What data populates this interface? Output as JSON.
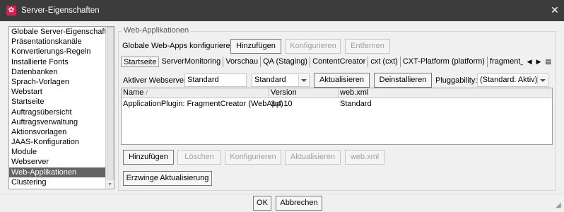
{
  "window": {
    "title": "Server-Eigenschaften",
    "close_glyph": "✕"
  },
  "sidebar": {
    "items": [
      {
        "label": "Globale Server-Eigenschaften"
      },
      {
        "label": "Präsentationskanäle"
      },
      {
        "label": "Konvertierungs-Regeln"
      },
      {
        "label": "Installierte Fonts"
      },
      {
        "label": "Datenbanken"
      },
      {
        "label": "Sprach-Vorlagen"
      },
      {
        "label": "Webstart"
      },
      {
        "label": "Startseite"
      },
      {
        "label": "Auftragsübersicht"
      },
      {
        "label": "Auftragsverwaltung"
      },
      {
        "label": "Aktionsvorlagen"
      },
      {
        "label": "JAAS-Konfiguration"
      },
      {
        "label": "Module"
      },
      {
        "label": "Webserver"
      },
      {
        "label": "Web-Applikationen",
        "selected": true
      },
      {
        "label": "Clustering"
      }
    ]
  },
  "main": {
    "group_title": "Web-Applikationen",
    "global_label": "Globale Web-Apps konfigurieren:",
    "global_buttons": {
      "add": "Hinzufügen",
      "configure": "Konfigurieren",
      "remove": "Entfernen"
    },
    "tabs": [
      {
        "label": "Startseite",
        "active": true
      },
      {
        "label": "ServerMonitoring"
      },
      {
        "label": "Vorschau"
      },
      {
        "label": "QA (Staging)"
      },
      {
        "label": "ContentCreator"
      },
      {
        "label": "cxt (cxt)"
      },
      {
        "label": "CXT-Platform (platform)"
      },
      {
        "label": "fragment_creator ("
      }
    ],
    "tab_nav": {
      "prev": "◀",
      "next": "▶",
      "list": "▤"
    },
    "webserver": {
      "label": "Aktiver Webserver:",
      "value": "Standard",
      "select_value": "Standard",
      "update_button": "Aktualisieren",
      "uninstall_button": "Deinstallieren",
      "pluggability_label": "Pluggability:",
      "pluggability_value": "(Standard: Aktiv)"
    },
    "table": {
      "columns": [
        "Name",
        "Version",
        "web.xml"
      ],
      "sort_glyph": "/",
      "rows": [
        [
          "ApplicationPlugin: FragmentCreator (WebApp)",
          "3.4.10",
          "Standard"
        ]
      ]
    },
    "table_buttons": {
      "add": "Hinzufügen",
      "delete": "Löschen",
      "configure": "Konfigurieren",
      "update": "Aktualisieren",
      "webxml": "web.xml"
    },
    "force_update_button": "Erzwinge Aktualisierung"
  },
  "footer": {
    "ok": "OK",
    "cancel": "Abbrechen"
  }
}
